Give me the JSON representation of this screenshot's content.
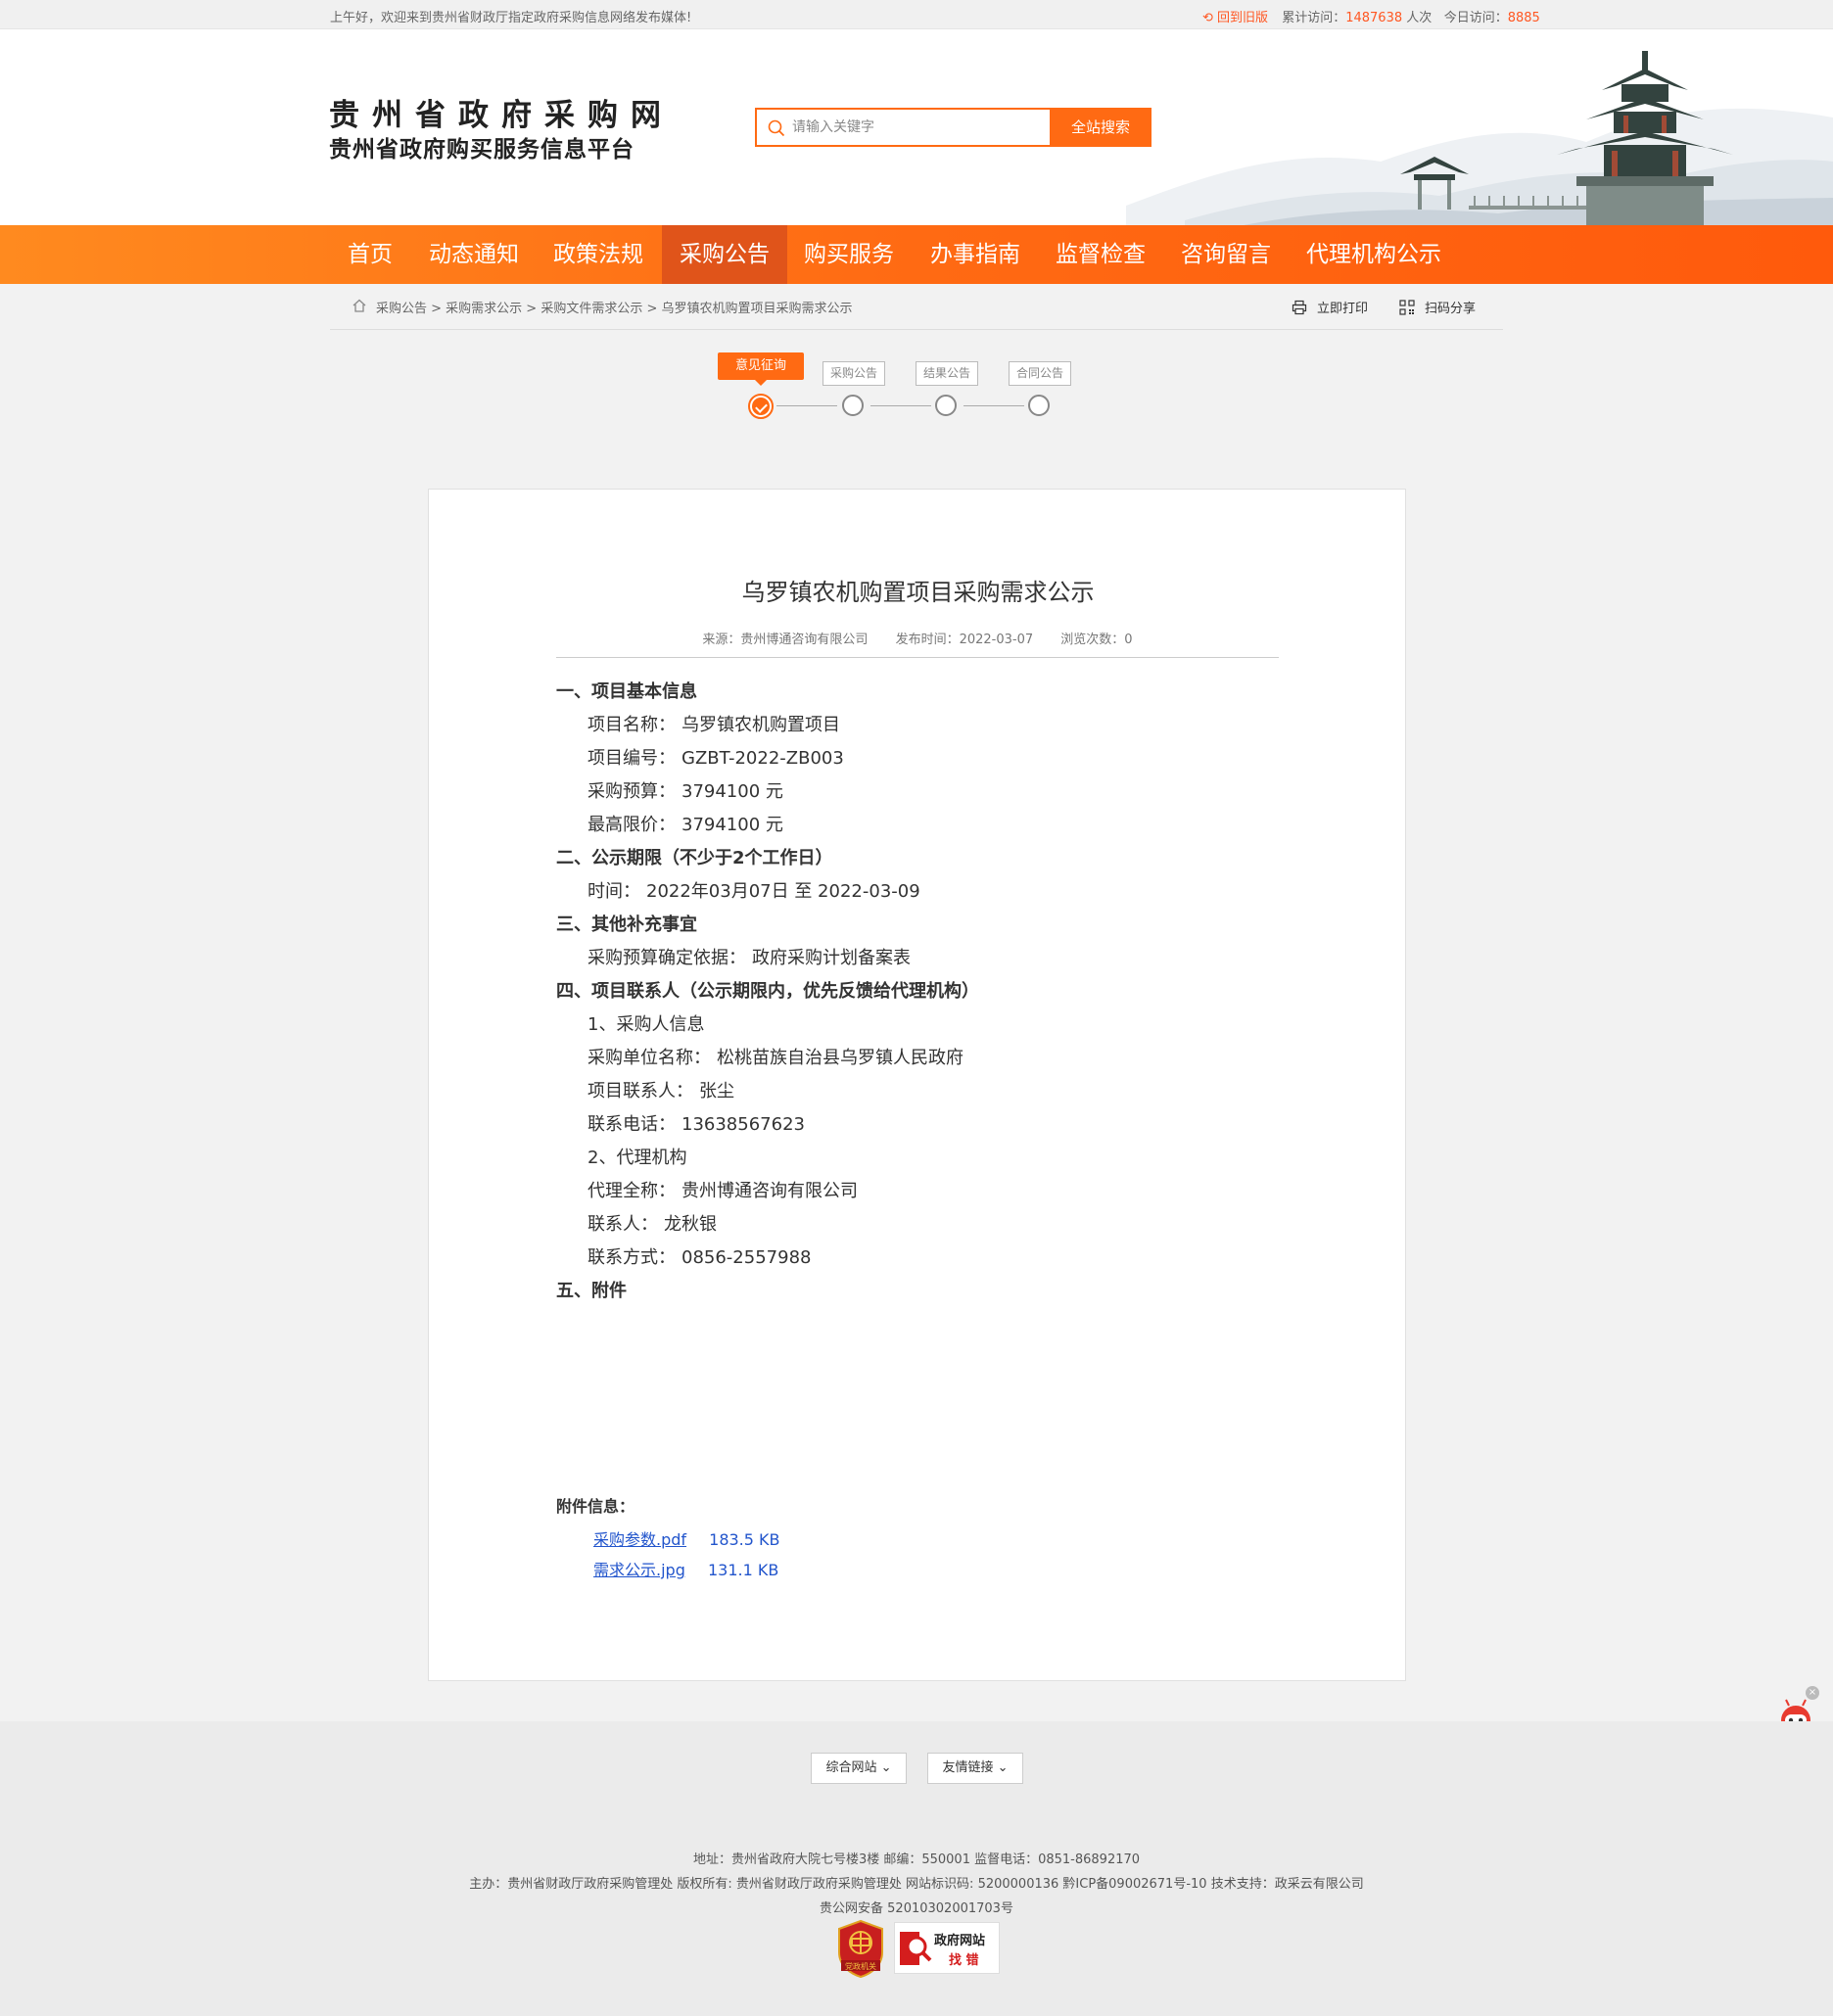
{
  "topbar": {
    "welcome": "上午好，欢迎来到贵州省财政厅指定政府采购信息网络发布媒体!",
    "old_version": "回到旧版",
    "total_label": "累计访问：",
    "total_value": "1487638",
    "total_unit": "人次",
    "today_label": "今日访问：",
    "today_value": "8885"
  },
  "header": {
    "logo_line1": "贵州省政府采购网",
    "logo_line2": "贵州省政府购买服务信息平台",
    "search_placeholder": "请输入关键字",
    "search_button": "全站搜索"
  },
  "nav": {
    "items": [
      "首页",
      "动态通知",
      "政策法规",
      "采购公告",
      "购买服务",
      "办事指南",
      "监督检查",
      "咨询留言",
      "代理机构公示"
    ],
    "active": "采购公告"
  },
  "breadcrumb": {
    "path": "采购公告 > 采购需求公示 > 采购文件需求公示 > 乌罗镇农机购置项目采购需求公示",
    "print": "立即打印",
    "share": "扫码分享"
  },
  "steps": {
    "active": "意见征询",
    "others": [
      "采购公告",
      "结果公告",
      "合同公告"
    ]
  },
  "article": {
    "title": "乌罗镇农机购置项目采购需求公示",
    "source": "来源：贵州博通咨询有限公司",
    "publish_time": "发布时间：2022-03-07",
    "views": "浏览次数：0",
    "sections": {
      "s1": "一、项目基本信息",
      "s1_name_label": "项目名称：",
      "s1_name_value": "乌罗镇农机购置项目",
      "s1_code_label": "项目编号：",
      "s1_code_value": "GZBT-2022-ZB003",
      "s1_budget_label": "采购预算：",
      "s1_budget_value": "3794100 元",
      "s1_max_label": "最高限价：",
      "s1_max_value": "3794100 元",
      "s2": "二、公示期限（不少于2个工作日）",
      "s2_time_label": "时间：",
      "s2_time_value": "2022年03月07日 至  2022-03-09",
      "s3": "三、其他补充事宜",
      "s3_basis_label": "采购预算确定依据：",
      "s3_basis_value": "政府采购计划备案表",
      "s4": "四、项目联系人（公示期限内，优先反馈给代理机构）",
      "s4_sub1": "1、采购人信息",
      "s4_unit_label": "采购单位名称：",
      "s4_unit_value": "松桃苗族自治县乌罗镇人民政府",
      "s4_contact_label": "项目联系人：",
      "s4_contact_value": "张尘",
      "s4_phone_label": "联系电话：",
      "s4_phone_value": "13638567623",
      "s4_sub2": "2、代理机构",
      "s4_agent_label": "代理全称：",
      "s4_agent_value": "贵州博通咨询有限公司",
      "s4_agent_contact_label": "联系人：",
      "s4_agent_contact_value": "龙秋银",
      "s4_agent_phone_label": "联系方式：",
      "s4_agent_phone_value": "0856-2557988",
      "s5": "五、附件"
    },
    "attachments_label": "附件信息：",
    "attachments": [
      {
        "name": "采购参数.pdf",
        "size": "183.5 KB"
      },
      {
        "name": "需求公示.jpg",
        "size": "131.1 KB"
      }
    ]
  },
  "footer": {
    "dropdown1": "综合网站",
    "dropdown2": "友情链接",
    "line1": "地址：贵州省政府大院七号楼3楼    邮编：550001    监督电话：0851-86892170",
    "line2": "主办：贵州省财政厅政府采购管理处    版权所有: 贵州省财政厅政府采购管理处    网站标识码: 5200000136    黔ICP备09002671号-10    技术支持：政采云有限公司",
    "line3": "贵公网安备 52010302001703号",
    "badge1_text": "党政机关",
    "badge2_line1": "政府网站",
    "badge2_line2": "找  错"
  },
  "colors": {
    "accent": "#ff6a13",
    "nav_active": "#e0541a",
    "link": "#2255cc"
  }
}
